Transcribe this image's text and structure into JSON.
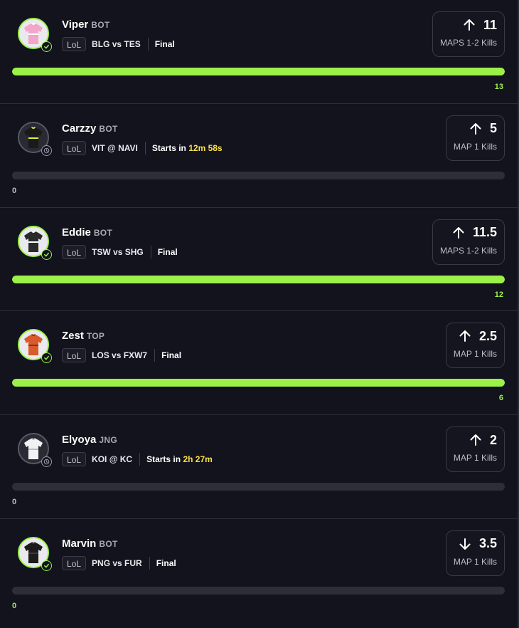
{
  "colors": {
    "accent": "#9cf04a",
    "countdown": "#fde047",
    "background": "#13131d"
  },
  "rows": [
    {
      "player": "Viper",
      "position": "BOT",
      "league": "LoL",
      "matchup": "BLG vs TES",
      "status": "Final",
      "countdown": "",
      "direction": "up",
      "line": "11",
      "stat": "MAPS 1-2 Kills",
      "result": "13",
      "progress": 1.0,
      "settled": true,
      "jersey_color": "#f2a6c8",
      "jersey_trim": "#ffffff",
      "result_side": "right"
    },
    {
      "player": "Carzzy",
      "position": "BOT",
      "league": "LoL",
      "matchup": "VIT @ NAVI",
      "status": "Starts in",
      "countdown": "12m 58s",
      "direction": "up",
      "line": "5",
      "stat": "MAP 1 Kills",
      "result": "0",
      "progress": 0,
      "settled": false,
      "jersey_color": "#1a1a1a",
      "jersey_trim": "#e8f03a",
      "result_side": "left"
    },
    {
      "player": "Eddie",
      "position": "BOT",
      "league": "LoL",
      "matchup": "TSW vs SHG",
      "status": "Final",
      "countdown": "",
      "direction": "up",
      "line": "11.5",
      "stat": "MAPS 1-2 Kills",
      "result": "12",
      "progress": 1.0,
      "settled": true,
      "jersey_color": "#2a2a2a",
      "jersey_trim": "#ffffff",
      "result_side": "right"
    },
    {
      "player": "Zest",
      "position": "TOP",
      "league": "LoL",
      "matchup": "LOS vs FXW7",
      "status": "Final",
      "countdown": "",
      "direction": "up",
      "line": "2.5",
      "stat": "MAP 1 Kills",
      "result": "6",
      "progress": 1.0,
      "settled": true,
      "jersey_color": "#d95b2b",
      "jersey_trim": "#8a2f12",
      "result_side": "right"
    },
    {
      "player": "Elyoya",
      "position": "JNG",
      "league": "LoL",
      "matchup": "KOI @ KC",
      "status": "Starts in",
      "countdown": "2h 27m",
      "direction": "up",
      "line": "2",
      "stat": "MAP 1 Kills",
      "result": "0",
      "progress": 0,
      "settled": false,
      "jersey_color": "#f1f1f4",
      "jersey_trim": "#b9b9c2",
      "result_side": "left"
    },
    {
      "player": "Marvin",
      "position": "BOT",
      "league": "LoL",
      "matchup": "PNG vs FUR",
      "status": "Final",
      "countdown": "",
      "direction": "down",
      "line": "3.5",
      "stat": "MAP 1 Kills",
      "result": "0",
      "progress": 0,
      "settled": true,
      "jersey_color": "#1b1b1b",
      "jersey_trim": "#3a3a3a",
      "result_side": "left"
    }
  ]
}
